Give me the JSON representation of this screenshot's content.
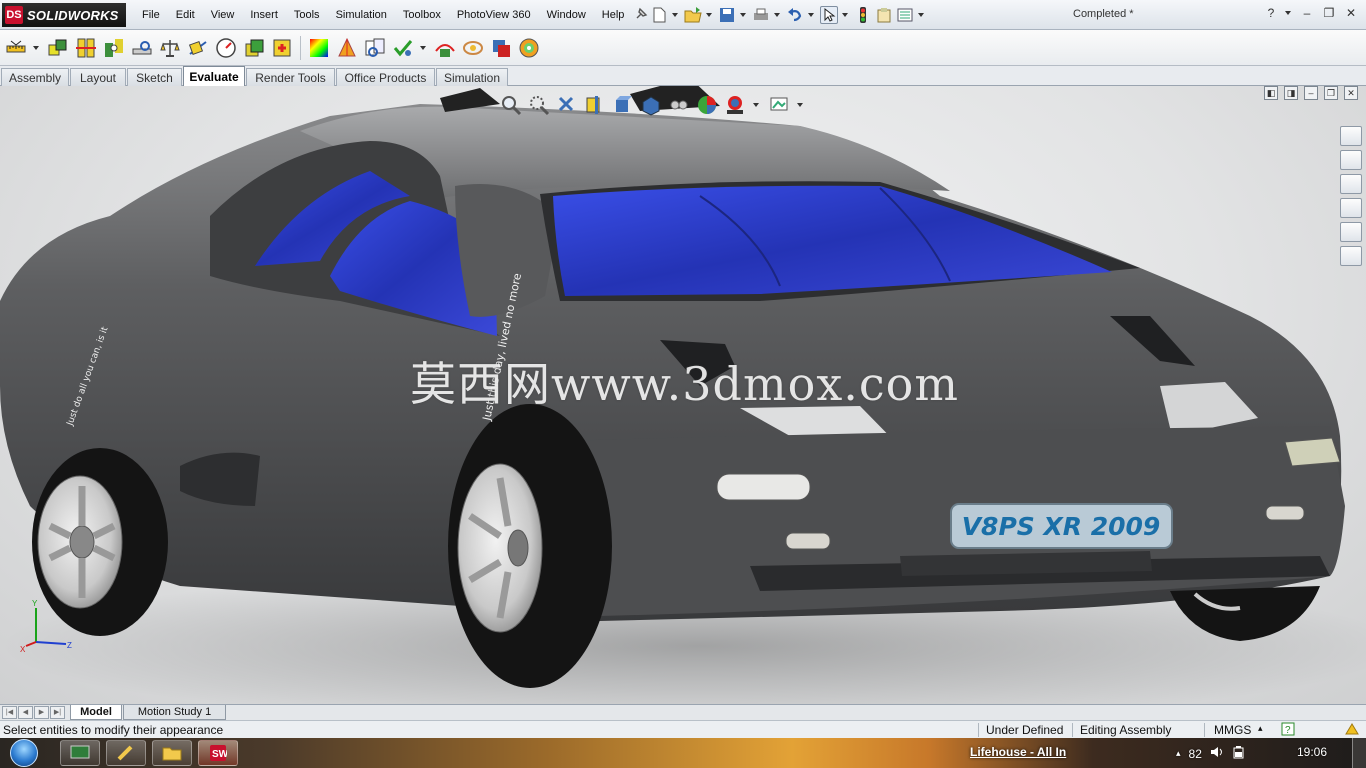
{
  "app": {
    "logo_badge": "DS",
    "logo_text": "SOLIDWORKS",
    "document_title": "Completed *"
  },
  "menu": [
    "File",
    "Edit",
    "View",
    "Insert",
    "Tools",
    "Simulation",
    "Toolbox",
    "PhotoView 360",
    "Window",
    "Help"
  ],
  "tabs": [
    "Assembly",
    "Layout",
    "Sketch",
    "Evaluate",
    "Render Tools",
    "Office Products",
    "Simulation"
  ],
  "active_tab": "Evaluate",
  "viewport": {
    "watermark": "莫西网www.3dmox.com",
    "license_plate": "V8PS XR 2009",
    "tyre_text_left": "Just do all you can, is it",
    "tyre_text_right": "Just this day, lived no more",
    "triad": {
      "x": "X",
      "y": "Y",
      "z": "Z"
    }
  },
  "bottom_tabs": [
    "Model",
    "Motion Study 1"
  ],
  "status": {
    "message": "Select entities to modify their appearance",
    "definition": "Under Defined",
    "mode": "Editing Assembly",
    "units": "MMGS",
    "units_arrow": "▴"
  },
  "taskbar": {
    "media_title": "Lifehouse - All In",
    "volume_level": "82",
    "clock": "19:06",
    "tray_arrow": "▴"
  },
  "colors": {
    "accent_red": "#c8102e",
    "glass_blue": "#2f3fd6",
    "body_gray": "#4a4a4c"
  }
}
